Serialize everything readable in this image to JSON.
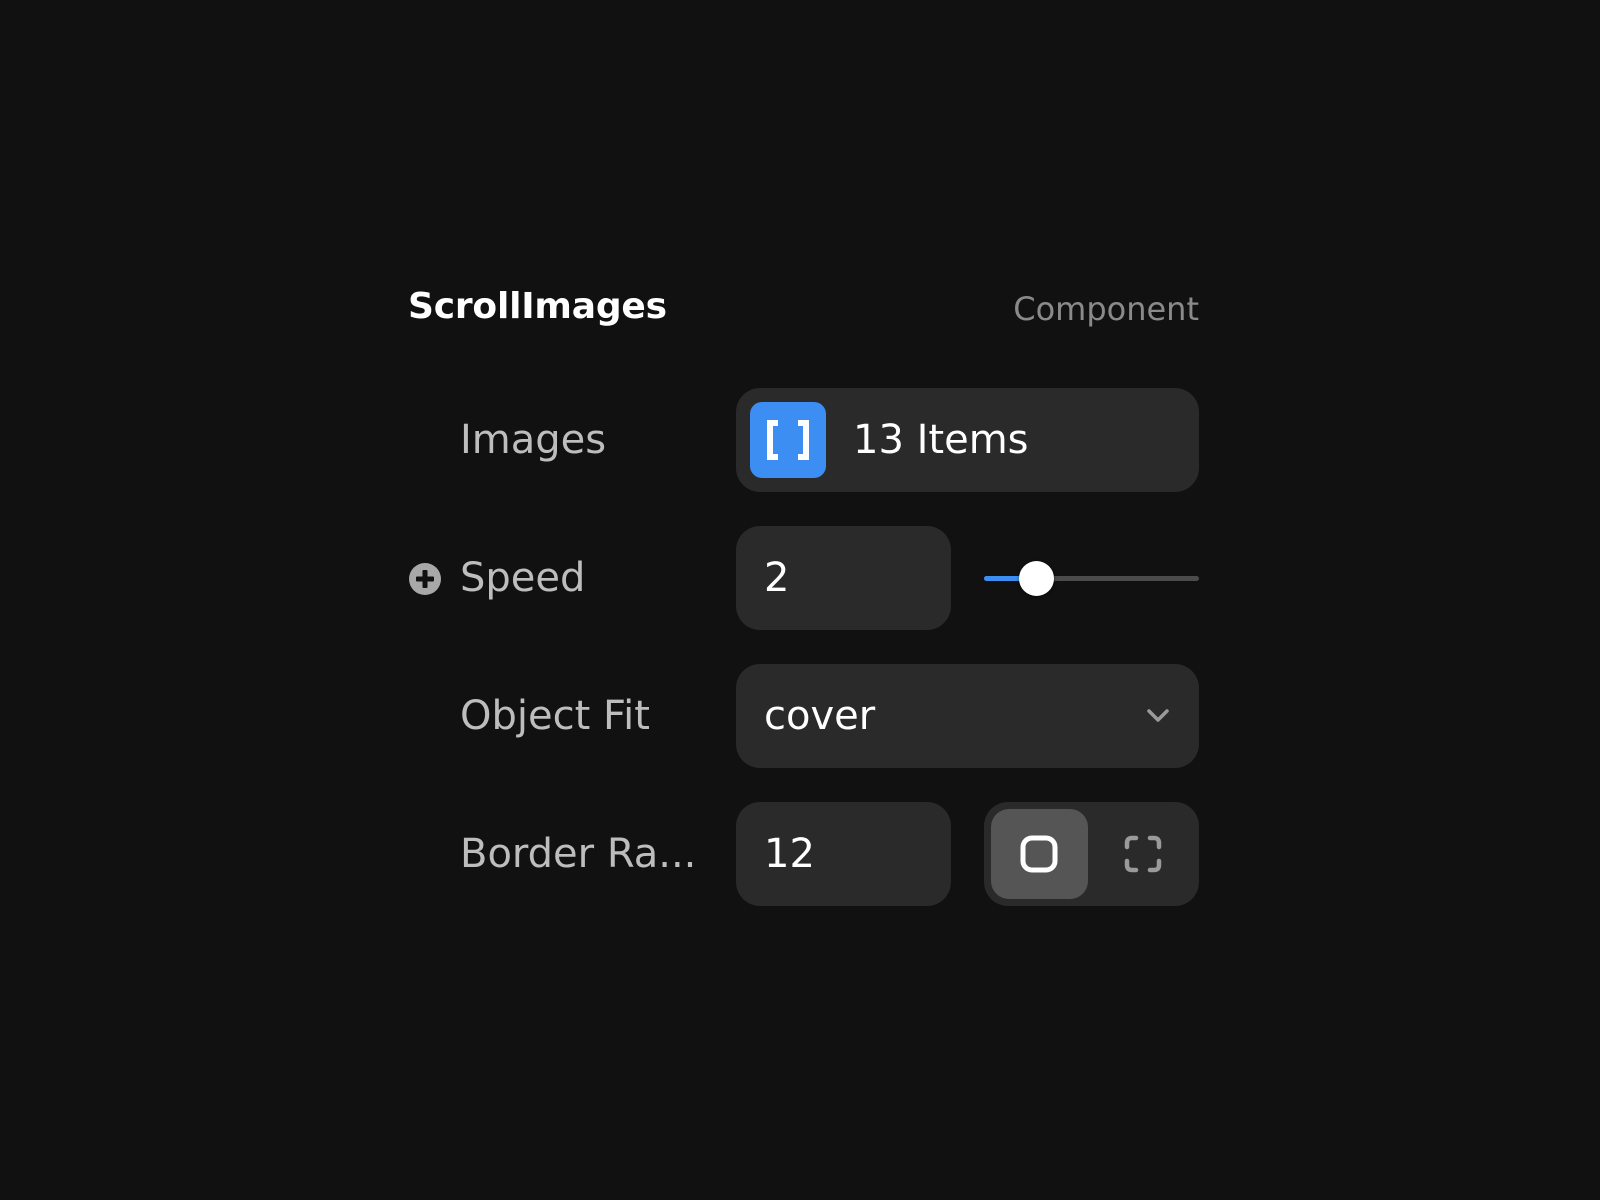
{
  "header": {
    "title": "ScrollImages",
    "subtitle": "Component"
  },
  "rows": {
    "images": {
      "label": "Images",
      "value": "13 Items",
      "icon": "array-brackets-icon"
    },
    "speed": {
      "label": "Speed",
      "value": "2",
      "slider_fraction": 0.24,
      "icon": "add-circle-icon"
    },
    "object_fit": {
      "label": "Object Fit",
      "value": "cover",
      "icon": "chevron-down-icon"
    },
    "border_radius": {
      "label": "Border Ra...",
      "value": "12",
      "modes": [
        "uniform-radius-icon",
        "per-corner-radius-icon"
      ],
      "active_mode": "uniform-radius-icon"
    }
  },
  "colors": {
    "background": "#111111",
    "field": "#2a2a2a",
    "accent": "#3d8ef3",
    "label": "#bdbdbd",
    "muted": "#8a8a8a"
  }
}
